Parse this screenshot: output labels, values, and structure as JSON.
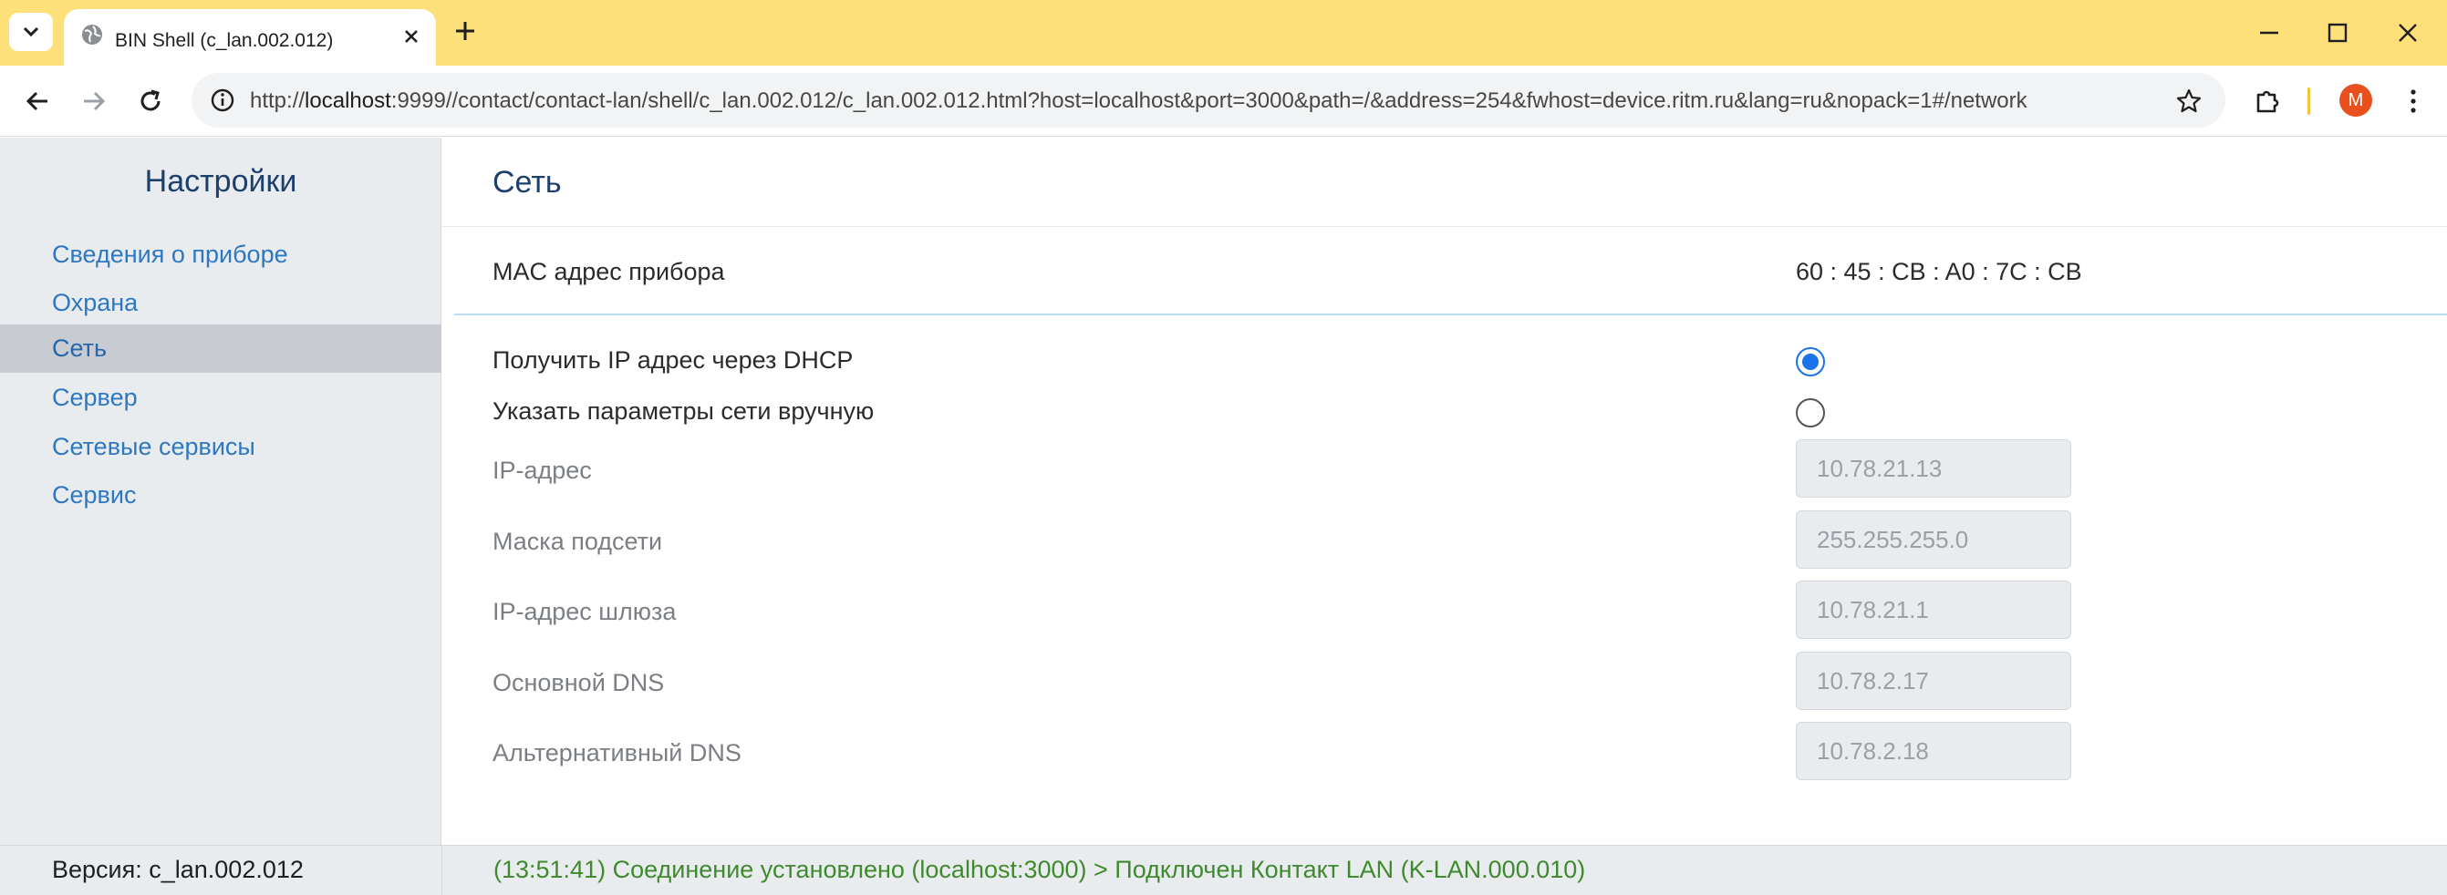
{
  "browser": {
    "tab_title": "BIN Shell (c_lan.002.012)",
    "url_prefix": "http://",
    "url_host": "localhost",
    "url_rest": ":9999//contact/contact-lan/shell/c_lan.002.012/c_lan.002.012.html?host=localhost&port=3000&path=/&address=254&fwhost=device.ritm.ru&lang=ru&nopack=1#/network",
    "profile_initial": "M",
    "accent_color": "#fde07a"
  },
  "sidebar": {
    "title": "Настройки",
    "items": [
      {
        "label": "Сведения о приборе",
        "active": false
      },
      {
        "label": "Охрана",
        "active": false
      },
      {
        "label": "Сеть",
        "active": true
      },
      {
        "label": "Сервер",
        "active": false
      },
      {
        "label": "Сетевые сервисы",
        "active": false
      },
      {
        "label": "Сервис",
        "active": false
      }
    ]
  },
  "main": {
    "title": "Сеть",
    "mac_label": "MAC адрес прибора",
    "mac_value": "60 : 45 : CB : A0 : 7C : CB",
    "radio_options": [
      {
        "label": "Получить IP адрес через DHCP",
        "checked": true
      },
      {
        "label": "Указать параметры сети вручную",
        "checked": false
      }
    ],
    "fields": [
      {
        "label": "IP-адрес",
        "value": "10.78.21.13"
      },
      {
        "label": "Маска подсети",
        "value": "255.255.255.0"
      },
      {
        "label": "IP-адрес шлюза",
        "value": "10.78.21.1"
      },
      {
        "label": "Основной DNS",
        "value": "10.78.2.17"
      },
      {
        "label": "Альтернативный DNS",
        "value": "10.78.2.18"
      }
    ]
  },
  "footer": {
    "version": "Версия: c_lan.002.012",
    "status": "(13:51:41) Соединение установлено (localhost:3000) > Подключен Контакт LAN (K-LAN.000.010)",
    "status_color": "#3e8a2c"
  }
}
